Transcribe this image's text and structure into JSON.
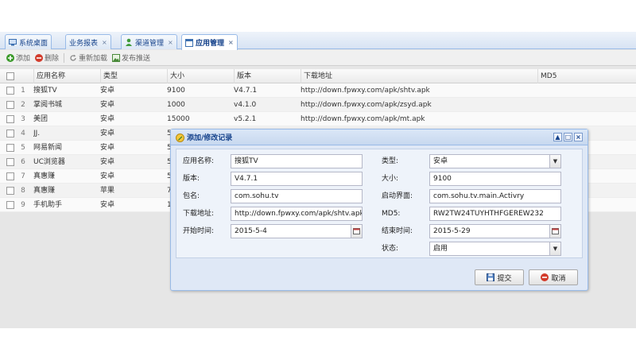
{
  "tabs": [
    {
      "label": "系统桌面",
      "closable": false,
      "active": false
    },
    {
      "label": "业务报表",
      "closable": true,
      "active": false
    },
    {
      "label": "渠道管理",
      "closable": true,
      "active": false
    },
    {
      "label": "应用管理",
      "closable": true,
      "active": true
    }
  ],
  "toolbar": {
    "add_label": "添加",
    "delete_label": "删除",
    "reload_label": "重新加载",
    "publish_label": "发布推送"
  },
  "grid": {
    "columns": [
      "应用名称",
      "类型",
      "大小",
      "版本",
      "下载地址",
      "MD5"
    ],
    "rows": [
      {
        "num": "1",
        "name": "搜狐TV",
        "type": "安卓",
        "size": "9100",
        "version": "V4.7.1",
        "url": "http://down.fpwxy.com/apk/shtv.apk",
        "md5": ""
      },
      {
        "num": "2",
        "name": "掌阅书城",
        "type": "安卓",
        "size": "1000",
        "version": "v4.1.0",
        "url": "http://down.fpwxy.com/apk/zsyd.apk",
        "md5": ""
      },
      {
        "num": "3",
        "name": "美团",
        "type": "安卓",
        "size": "15000",
        "version": "v5.2.1",
        "url": "http://down.fpwxy.com/apk/mt.apk",
        "md5": ""
      },
      {
        "num": "4",
        "name": "JJ.",
        "type": "安卓",
        "size": "5",
        "version": "",
        "url": "",
        "md5": ""
      },
      {
        "num": "5",
        "name": "网易新闻",
        "type": "安卓",
        "size": "5",
        "version": "",
        "url": "",
        "md5": ""
      },
      {
        "num": "6",
        "name": "UC浏览器",
        "type": "安卓",
        "size": "5",
        "version": "",
        "url": "",
        "md5": ""
      },
      {
        "num": "7",
        "name": "真惠赚",
        "type": "安卓",
        "size": "5",
        "version": "",
        "url": "",
        "md5": ""
      },
      {
        "num": "8",
        "name": "真惠赚",
        "type": "苹果",
        "size": "7",
        "version": "",
        "url": "",
        "md5": ""
      },
      {
        "num": "9",
        "name": "手机助手",
        "type": "安卓",
        "size": "1",
        "version": "",
        "url": "",
        "md5": ""
      }
    ]
  },
  "dialog": {
    "title": "添加/修改记录",
    "tools": [
      "▲",
      "□",
      "×"
    ],
    "fields": {
      "app_name": {
        "label": "应用名称:",
        "value": "搜狐TV"
      },
      "type": {
        "label": "类型:",
        "value": "安卓"
      },
      "version": {
        "label": "版本:",
        "value": "V4.7.1"
      },
      "size": {
        "label": "大小:",
        "value": "9100"
      },
      "package": {
        "label": "包名:",
        "value": "com.sohu.tv"
      },
      "launch": {
        "label": "启动界面:",
        "value": "com.sohu.tv.main.Activry"
      },
      "url": {
        "label": "下载地址:",
        "value": "http://down.fpwxy.com/apk/shtv.apk"
      },
      "md5": {
        "label": "MD5:",
        "value": "RW2TW24TUYHTHFGEREW232"
      },
      "start": {
        "label": "开始时间:",
        "value": "2015-5-4"
      },
      "end": {
        "label": "结束时间:",
        "value": "2015-5-29"
      },
      "status": {
        "label": "状态:",
        "value": "启用"
      }
    },
    "submit_label": "提交",
    "cancel_label": "取消"
  },
  "colors": {
    "accent": "#15428b",
    "border": "#99bbe8",
    "add_green": "#3a9a2a",
    "delete_red": "#d23b2b"
  }
}
